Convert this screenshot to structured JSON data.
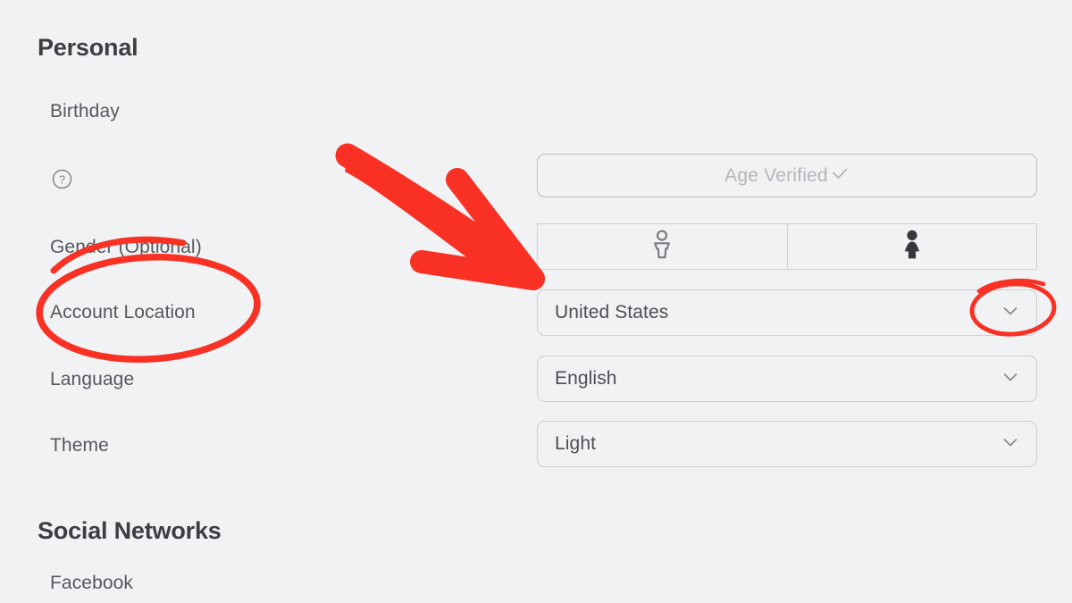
{
  "theme": {
    "background": "#f1f2f4",
    "heading_color": "#3b3e43",
    "label_color": "#55585e",
    "value_color": "#4b4e54",
    "muted_color": "#b3b6bb",
    "border_color": "#ccced2",
    "annotation_color": "#f93024"
  },
  "sections": {
    "personal": {
      "title": "Personal",
      "fields": {
        "birthday": {
          "label": "Birthday"
        },
        "age_verified": {
          "label": "Age Verified",
          "icon": "check-icon",
          "state": "verified"
        },
        "gender": {
          "label": "Gender (Optional)",
          "options": [
            {
              "icon": "male-person-icon",
              "selected": false
            },
            {
              "icon": "female-person-icon",
              "selected": true
            }
          ]
        },
        "account_location": {
          "label": "Account Location",
          "value": "United States",
          "icon": "chevron-down-icon"
        },
        "language": {
          "label": "Language",
          "value": "English",
          "icon": "chevron-down-icon"
        },
        "theme": {
          "label": "Theme",
          "value": "Light",
          "icon": "chevron-down-icon"
        }
      },
      "help": {
        "icon": "question-mark-circle-icon"
      }
    },
    "social": {
      "title": "Social Networks",
      "fields": {
        "facebook": {
          "label": "Facebook"
        }
      }
    }
  },
  "annotations": {
    "arrow": {
      "shape": "arrow-down-right",
      "color": "#f93024",
      "points_to": "account-location-dropdown"
    },
    "ellipse_label": {
      "shape": "ellipse",
      "color": "#f93024",
      "around": "Account Location"
    },
    "ellipse_chevron": {
      "shape": "ellipse",
      "color": "#f93024",
      "around": "chevron-down-icon"
    }
  }
}
